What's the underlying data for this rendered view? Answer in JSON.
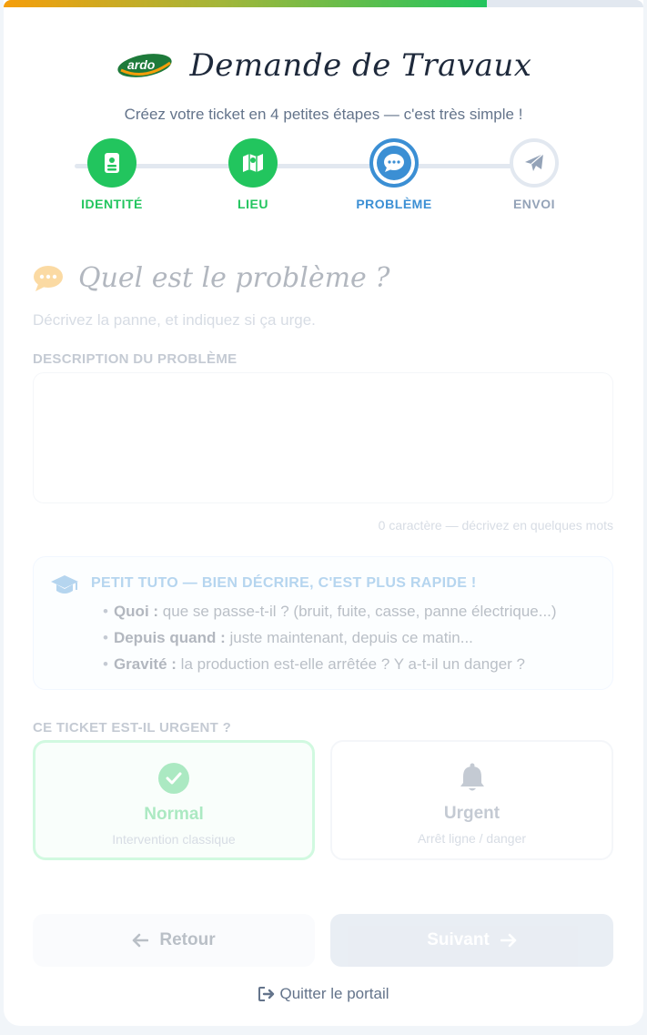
{
  "progress": {
    "fraction": 0.755
  },
  "header": {
    "logo_text": "ardo",
    "title": "Demande de Travaux",
    "subtitle": "Créez votre ticket en 4 petites étapes — c'est très simple !"
  },
  "steps": [
    {
      "label": "IDENTITÉ",
      "state": "done",
      "icon": "id-card-icon"
    },
    {
      "label": "LIEU",
      "state": "done",
      "icon": "map-icon"
    },
    {
      "label": "PROBLÈME",
      "state": "active",
      "icon": "chat-icon"
    },
    {
      "label": "ENVOI",
      "state": "todo",
      "icon": "paper-plane-icon"
    }
  ],
  "section": {
    "title": "Quel est le problème ?",
    "description": "Décrivez la panne, et indiquez si ça urge."
  },
  "description_field": {
    "label": "DESCRIPTION DU PROBLÈME",
    "value": "",
    "char_count": "0 caractère — décrivez en quelques mots"
  },
  "tuto": {
    "title": "PETIT TUTO — BIEN DÉCRIRE, C'EST PLUS RAPIDE !",
    "items": [
      {
        "bold": "Quoi :",
        "text": " que se passe-t-il ? (bruit, fuite, casse, panne électrique...)"
      },
      {
        "bold": "Depuis quand :",
        "text": " juste maintenant, depuis ce matin..."
      },
      {
        "bold": "Gravité :",
        "text": " la production est-elle arrêtée ? Y a-t-il un danger ?"
      }
    ]
  },
  "urgency": {
    "label": "CE TICKET EST-IL URGENT ?",
    "selected": "Normal",
    "options": [
      {
        "name": "Normal",
        "sub": "Intervention classique",
        "icon": "check-circle-icon"
      },
      {
        "name": "Urgent",
        "sub": "Arrêt ligne / danger",
        "icon": "bell-icon"
      }
    ]
  },
  "buttons": {
    "back": "Retour",
    "next": "Suivant"
  },
  "quit": "Quitter le portail",
  "colors": {
    "green": "#22c55e",
    "blue": "#3b8fd4",
    "gray": "#94a3b8"
  }
}
